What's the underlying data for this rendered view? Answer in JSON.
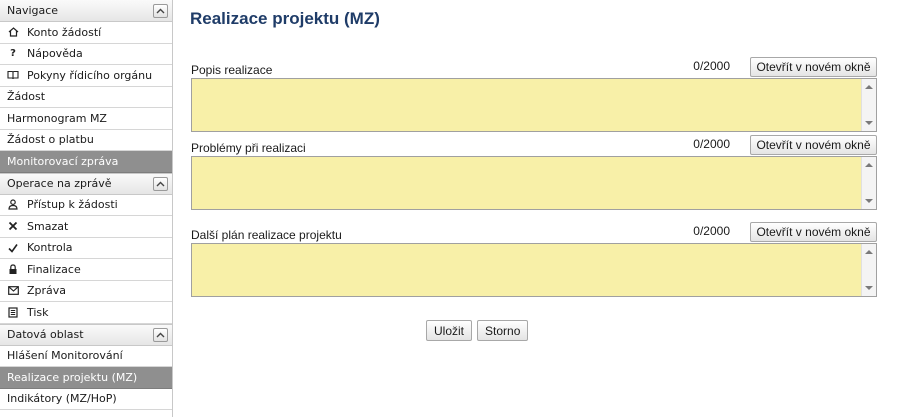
{
  "sidebar": {
    "navigation": {
      "header": "Navigace",
      "items": [
        {
          "label": "Konto žádostí",
          "icon": "home-icon"
        },
        {
          "label": "Nápověda",
          "icon": "help-icon"
        },
        {
          "label": "Pokyny řídicího orgánu",
          "icon": "book-icon"
        }
      ]
    },
    "links": [
      {
        "label": "Žádost"
      },
      {
        "label": "Harmonogram MZ"
      },
      {
        "label": "Žádost o platbu"
      }
    ],
    "active_section": "Monitorovací zpráva",
    "operations": {
      "header": "Operace na zprávě",
      "items": [
        {
          "label": "Přístup k žádosti",
          "icon": "user-icon"
        },
        {
          "label": "Smazat",
          "icon": "delete-icon"
        },
        {
          "label": "Kontrola",
          "icon": "check-icon"
        },
        {
          "label": "Finalizace",
          "icon": "lock-icon"
        },
        {
          "label": "Zpráva",
          "icon": "envelope-icon"
        },
        {
          "label": "Tisk",
          "icon": "print-icon"
        }
      ]
    },
    "data_area": {
      "header": "Datová oblast",
      "items": [
        {
          "label": "Hlášení Monitorování"
        },
        {
          "label": "Realizace projektu (MZ)",
          "active": true
        },
        {
          "label": "Indikátory (MZ/HoP)"
        }
      ]
    }
  },
  "main": {
    "title": "Realizace projektu (MZ)",
    "fields": [
      {
        "label": "Popis realizace",
        "counter": "0/2000",
        "open_button": "Otevřít v novém okně",
        "value": ""
      },
      {
        "label": "Problémy při realizaci",
        "counter": "0/2000",
        "open_button": "Otevřít v novém okně",
        "value": ""
      },
      {
        "label": "Další plán realizace projektu",
        "counter": "0/2000",
        "open_button": "Otevřít v novém okně",
        "value": ""
      }
    ],
    "save_label": "Uložit",
    "cancel_label": "Storno"
  },
  "colors": {
    "title": "#1f3c68",
    "textarea_bg": "#f8f0a8",
    "active_item_bg": "#8f8f8f"
  }
}
